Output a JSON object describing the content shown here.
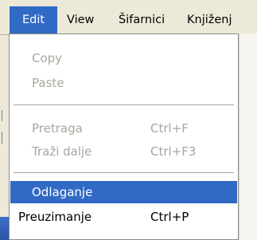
{
  "menubar": {
    "items": [
      "Edit",
      "View",
      "Šifarnici",
      "Knjiženj"
    ]
  },
  "edit_menu": {
    "copy": "Copy",
    "paste": "Paste",
    "pretraga": "Pretraga",
    "pretraga_shortcut": "Ctrl+F",
    "trazi_dalje": "Traži dalje",
    "trazi_dalje_shortcut": "Ctrl+F3",
    "odlaganje": "Odlaganje",
    "preuzimanje": "Preuzimanje",
    "preuzimanje_shortcut": "Ctrl+P"
  },
  "colors": {
    "highlight": "#316ac5",
    "disabled_text": "#a7a69d",
    "menubar_bg": "#ece9d8"
  }
}
